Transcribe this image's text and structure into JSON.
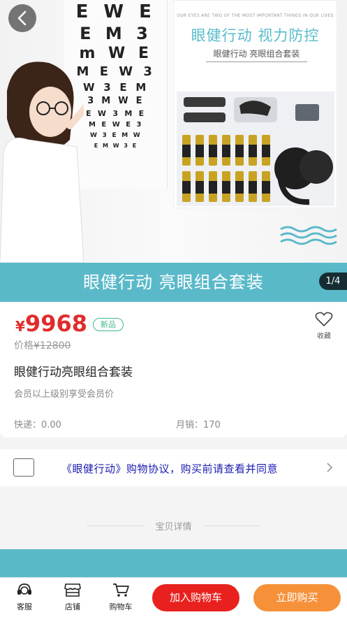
{
  "banner": {
    "caption": "眼健行动 亮眼组合套装",
    "page_indicator": "1/4",
    "promo_english": "OUR EYES ARE TWO OF THE MOST IMPORTANT THINGS IN OUR LIVES",
    "promo_title": "眼健行动 视力防控",
    "promo_subtitle": "眼健行动 亮眼组合套装",
    "chart_rows": [
      "E W E",
      "E M 3",
      "m W E",
      "M E W 3",
      "W 3 E M",
      "3 M W E",
      "E W 3 M E",
      "M E W E 3",
      "W 3 E M W",
      "E M W 3 E"
    ],
    "colors": {
      "strip": "#5ab9c9",
      "promo_title": "#58bccb"
    }
  },
  "product": {
    "currency_symbol": "¥",
    "price": "9968",
    "badge": "新品",
    "favorite_label": "收藏",
    "old_price_label": "价格",
    "old_price": "¥12800",
    "title": "眼健行动亮眼组合套装",
    "member_note": "会员以上级别享受会员价",
    "shipping": "快递：0.00",
    "monthly_sales": "月销：170",
    "colors": {
      "price": "#e02c2c",
      "badge": "#42b886"
    }
  },
  "agreement": {
    "text": "《眼健行动》购物协议，购买前请查看并同意",
    "checked": false
  },
  "details": {
    "label": "宝贝详情"
  },
  "bottom_bar": {
    "tabs": [
      {
        "label": "客服",
        "icon": "customer-service-icon"
      },
      {
        "label": "店铺",
        "icon": "store-icon"
      },
      {
        "label": "购物车",
        "icon": "cart-icon"
      }
    ],
    "add_to_cart": "加入购物车",
    "buy_now": "立即购买",
    "colors": {
      "add_to_cart": "#e8211e",
      "buy_now": "#f6913a"
    }
  }
}
